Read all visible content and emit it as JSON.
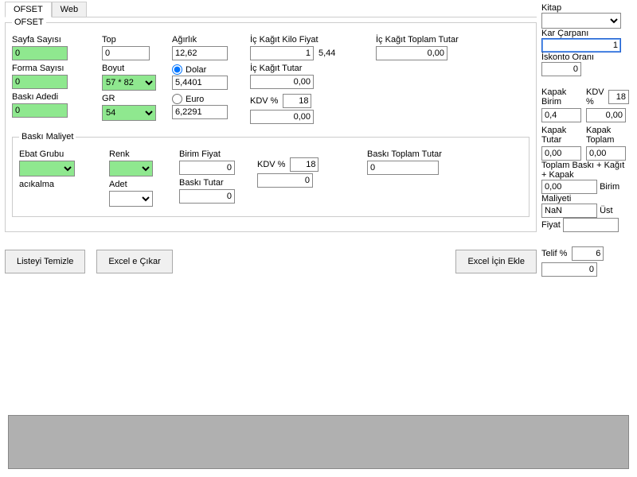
{
  "tabs": {
    "ofset": "OFSET",
    "web": "Web"
  },
  "fieldset_main": "OFSET",
  "left": {
    "sayfa_label": "Sayfa Sayısı",
    "sayfa_value": "0",
    "forma_label": "Forma Sayısı",
    "forma_value": "0",
    "baski_label": "Baskı Adedi",
    "baski_value": "0"
  },
  "center": {
    "top_label": "Top",
    "top_value": "0",
    "boyut_label": "Boyut",
    "boyut_value": "57 * 82",
    "gr_label": "GR",
    "gr_value": "54"
  },
  "agirlik": {
    "label": "Ağırlık",
    "value": "12,62",
    "dolar_label": "Dolar",
    "dolar_value": "5,4401",
    "euro_label": "Euro",
    "euro_value": "6,2291"
  },
  "kagit": {
    "kilo_label": "İç Kağıt Kilo Fiyat",
    "kilo_value": "1",
    "kilo_calc": "5,44",
    "tutar_label": "İç Kağıt Tutar",
    "tutar_value": "0,00",
    "kdv_label": "KDV %",
    "kdv_value": "18",
    "kdv_tutar": "0,00",
    "toplam_label": "İç Kağıt Toplam Tutar",
    "toplam_value": "0,00"
  },
  "maliyet": {
    "legend": "Baskı Maliyet",
    "ebat_label": "Ebat Grubu",
    "renk_label": "Renk",
    "birim_label": "Birim Fiyat",
    "birim_value": "0",
    "kdv_label": "KDV %",
    "kdv_value": "18",
    "kdv_tutar": "0",
    "toplam_label": "Baskı Toplam Tutar",
    "toplam_value": "0",
    "acikalma": "acıkalma",
    "adet_label": "Adet",
    "baski_tutar_label": "Baskı Tutar",
    "baski_tutar_value": "0"
  },
  "buttons": {
    "temizle": "Listeyi Temizle",
    "excel_cikar": "Excel e Çıkar",
    "excel_ekle": "Excel İçin Ekle"
  },
  "side": {
    "kitap_label": "Kitap",
    "kar_label": "Kar Çarpanı",
    "kar_value": "1",
    "iskonto_label": "İskonto Oranı",
    "iskonto_value": "0",
    "kapak_birim_label": "Kapak Birim",
    "kapak_birim_value": "0,4",
    "kdv_label": "KDV %",
    "kdv_value": "18",
    "kdv_tutar": "0,00",
    "kapak_tutar_label": "Kapak Tutar",
    "kapak_tutar_value": "0,00",
    "kapak_toplam_label": "Kapak Toplam",
    "kapak_toplam_value": "0,00",
    "toplam_label": "Toplam Baskı + Kağıt + Kapak",
    "toplam_value": "0,00",
    "birim_maliyet_label": "Birim Maliyeti",
    "birim_maliyet_value": "NaN",
    "ust_fiyat_label": "Üst Fiyat",
    "ust_fiyat_value": "",
    "telif_label": "Telif %",
    "telif_value": "6",
    "telif_tutar": "0"
  }
}
